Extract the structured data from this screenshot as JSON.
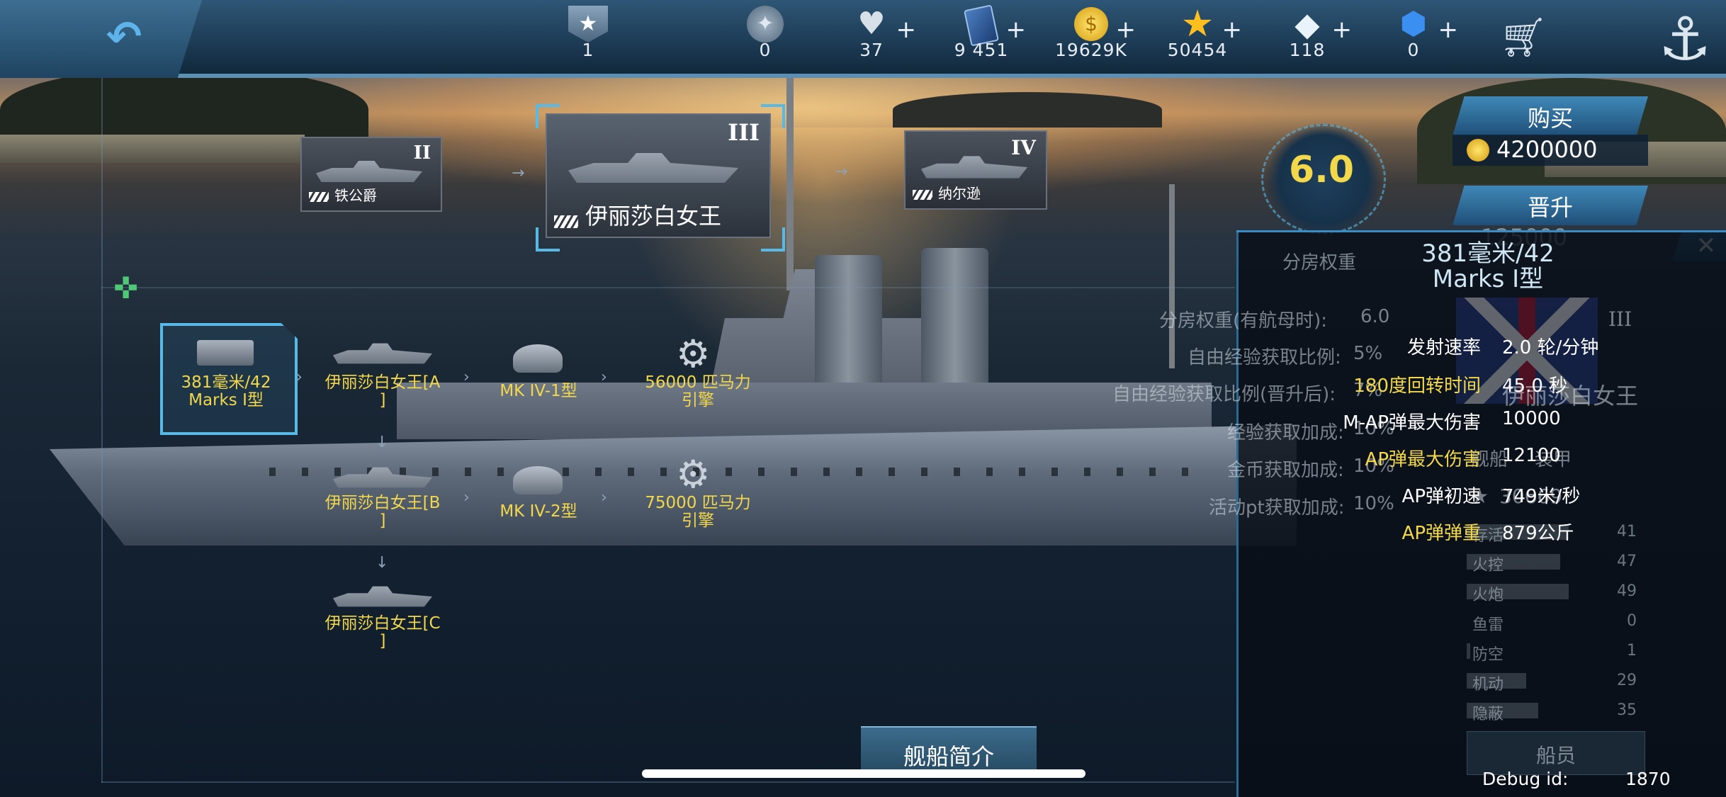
{
  "topbar": {
    "resources": [
      {
        "name": "rank",
        "icon": "rank-badge-icon",
        "value": "1",
        "plus": false
      },
      {
        "name": "medal",
        "icon": "medal-icon",
        "value": "0",
        "plus": false
      },
      {
        "name": "stamina",
        "icon": "heart-icon",
        "value": "37",
        "plus": true
      },
      {
        "name": "cards",
        "icon": "card-icon",
        "value": "9 451",
        "plus": true
      },
      {
        "name": "gold",
        "icon": "gold-coin-icon",
        "value": "19629K",
        "plus": true
      },
      {
        "name": "stars",
        "icon": "star-icon",
        "value": "50454",
        "plus": true
      },
      {
        "name": "diamonds",
        "icon": "diamond-icon",
        "value": "118",
        "plus": true
      },
      {
        "name": "gems",
        "icon": "blue-gem-icon",
        "value": "0",
        "plus": true
      }
    ],
    "plus_symbol": "+"
  },
  "tree": {
    "ships": [
      {
        "tier": "II",
        "name": "铁公爵"
      },
      {
        "tier": "III",
        "name": "伊丽莎白女王"
      },
      {
        "tier": "IV",
        "name": "纳尔逊"
      }
    ],
    "modules": [
      {
        "label_1": "381毫米/42",
        "label_2": "Marks I型"
      },
      {
        "label_1": "伊丽莎白女王[A",
        "label_2": "]"
      },
      {
        "label_1": "MK IV-1型",
        "label_2": ""
      },
      {
        "label_1": "56000 匹马力",
        "label_2": "引擎"
      },
      {
        "label_1": "伊丽莎白女王[B",
        "label_2": "]"
      },
      {
        "label_1": "MK IV-2型",
        "label_2": ""
      },
      {
        "label_1": "75000 匹马力",
        "label_2": "引擎"
      },
      {
        "label_1": "伊丽莎白女王[C",
        "label_2": "]"
      }
    ]
  },
  "rating": "6.0",
  "buy": {
    "label": "购买",
    "price": "4200000"
  },
  "upgrade": {
    "label": "晋升",
    "cost": "125000"
  },
  "close_symbol": "✕",
  "panel": {
    "title_1": "381毫米/42",
    "title_2": "Marks I型",
    "bg_text": {
      "room_weight": "分房权重",
      "room_weight_carrier": "分房权重(有航母时):",
      "room_weight_val": "6.0",
      "free_exp": "自由经验获取比例:",
      "free_exp_val": "5%",
      "free_exp_premium": "自由经验获取比例(晋升后):",
      "free_exp_premium_val": "7%",
      "exp_bonus": "经验获取加成:",
      "exp_bonus_val": "10%",
      "coin_bonus": "金币获取加成:",
      "coin_bonus_val": "10%",
      "pt_bonus": "活动pt获取加成:",
      "pt_bonus_val": "10%",
      "ship_name": "伊丽莎白女王",
      "tab_ship": "舰船",
      "tab_equip": "装甲",
      "score": "30669",
      "crew": "船员",
      "tier_mark": "III"
    },
    "stats": [
      {
        "key": "发射速率",
        "value": "2.0 轮/分钟",
        "key_color": "#ffffff"
      },
      {
        "key": "180度回转时间",
        "value": "45.0 秒",
        "key_color": "#f2d84a"
      },
      {
        "key": "M-AP弹最大伤害",
        "value": "10000",
        "key_color": "#ffffff"
      },
      {
        "key": "AP弹最大伤害",
        "value": "12100",
        "key_color": "#f2d84a"
      },
      {
        "key": "AP弹初速",
        "value": "749米/秒",
        "key_color": "#ffffff"
      },
      {
        "key": "AP弹弹重",
        "value": "879公斤",
        "key_color": "#f2d84a"
      }
    ],
    "attributes": [
      {
        "label": "存活",
        "value": "41",
        "fill": 0.6
      },
      {
        "label": "火控",
        "value": "47",
        "fill": 0.55
      },
      {
        "label": "火炮",
        "value": "49",
        "fill": 0.6
      },
      {
        "label": "鱼雷",
        "value": "0",
        "fill": 0
      },
      {
        "label": "防空",
        "value": "1",
        "fill": 0.02
      },
      {
        "label": "机动",
        "value": "29",
        "fill": 0.35
      },
      {
        "label": "隐蔽",
        "value": "35",
        "fill": 0.42
      }
    ]
  },
  "intro_button": "舰船简介",
  "debug": {
    "label": "Debug id:",
    "value": "1870"
  }
}
